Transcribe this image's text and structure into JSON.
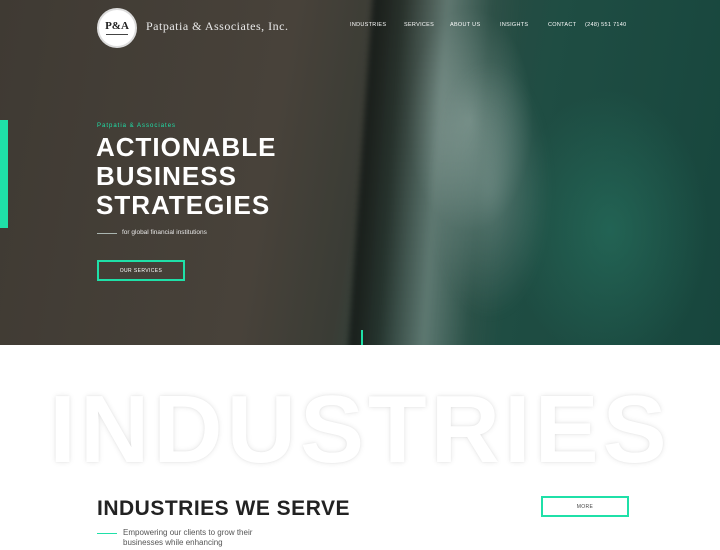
{
  "brand": {
    "monogram": "P&A",
    "name": "Patpatia & Associates, Inc."
  },
  "nav": {
    "items": [
      {
        "label": "INDUSTRIES"
      },
      {
        "label": "SERVICES"
      },
      {
        "label": "ABOUT US"
      },
      {
        "label": "INSIGHTS"
      },
      {
        "label": "CONTACT"
      }
    ],
    "phone": "(248) 551 7140"
  },
  "hero": {
    "kicker": "Patpatia & Associates",
    "headline_lines": [
      "ACTIONABLE",
      "BUSINESS",
      "STRATEGIES"
    ],
    "subtitle": "for global financial institutions",
    "button_label": "OUR SERVICES"
  },
  "industries": {
    "watermark": "INDUSTRIES",
    "title": "INDUSTRIES WE SERVE",
    "more_label": "MORE",
    "description": "Empowering our clients to grow their businesses while enhancing"
  },
  "colors": {
    "accent": "#1fe0a8",
    "hero_dark": "#48423a",
    "hero_sea": "#17463d"
  }
}
